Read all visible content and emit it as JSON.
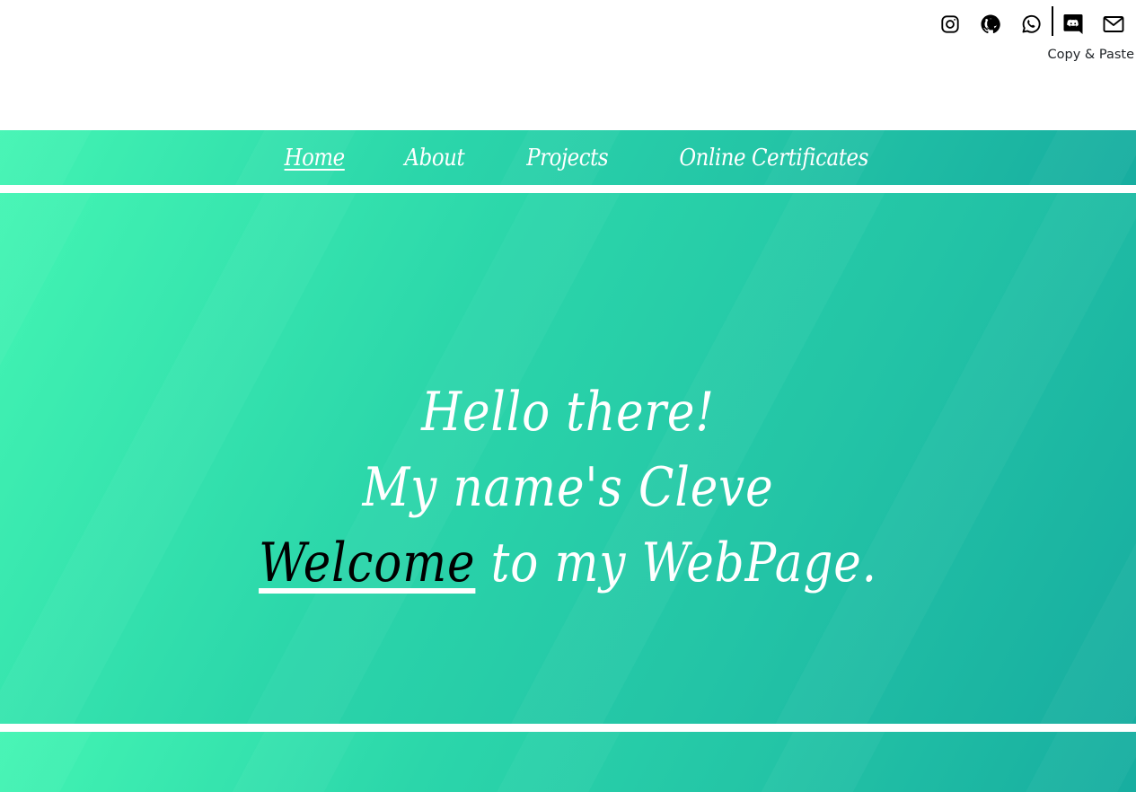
{
  "social": {
    "icons": [
      "instagram-icon",
      "github-icon",
      "whatsapp-icon",
      "discord-icon",
      "email-icon"
    ],
    "copy_paste_label": "Copy & Paste"
  },
  "nav": {
    "items": [
      {
        "label": "Home",
        "active": true
      },
      {
        "label": "About",
        "active": false
      },
      {
        "label": "Projects",
        "active": false
      },
      {
        "label": "Online Certificates",
        "active": false
      }
    ]
  },
  "hero": {
    "line1": "Hello there!",
    "line2": "My name's Cleve",
    "line3_highlight": "Welcome",
    "line3_rest": " to my WebPage."
  },
  "colors": {
    "gradient_start": "#43f5b3",
    "gradient_end": "#17ada0",
    "text": "#ffffff",
    "highlight": "#000000"
  }
}
